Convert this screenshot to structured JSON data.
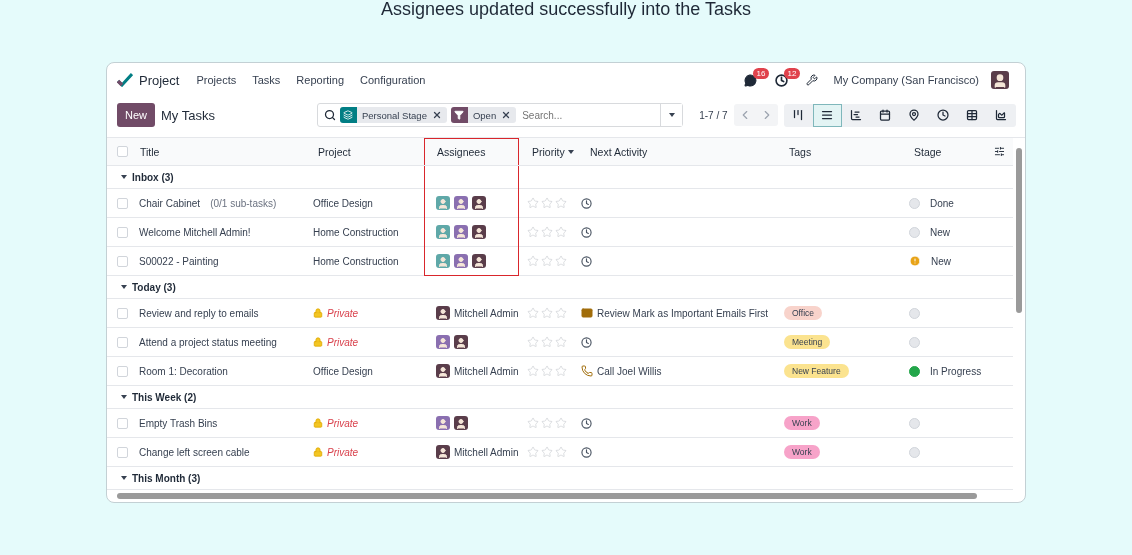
{
  "caption": "Assignees updated successfully into the Tasks",
  "navbar": {
    "app_name": "Project",
    "menu": [
      "Projects",
      "Tasks",
      "Reporting",
      "Configuration"
    ],
    "messages_count": "16",
    "activities_count": "12",
    "company": "My Company (San Francisco)"
  },
  "control_panel": {
    "new_button": "New",
    "title": "My Tasks",
    "facets": [
      {
        "kind": "group",
        "label": "Personal Stage"
      },
      {
        "kind": "filter",
        "label": "Open"
      }
    ],
    "search_placeholder": "Search...",
    "pager": "1-7 / 7",
    "views": [
      {
        "kind": "kanban",
        "selected": false
      },
      {
        "kind": "list",
        "selected": true
      },
      {
        "kind": "gantt",
        "selected": false
      },
      {
        "kind": "calendar",
        "selected": false
      },
      {
        "kind": "map",
        "selected": false
      },
      {
        "kind": "activity",
        "selected": false
      },
      {
        "kind": "pivot",
        "selected": false
      },
      {
        "kind": "graph",
        "selected": false
      }
    ]
  },
  "table": {
    "all_checked": false,
    "columns": [
      {
        "label": "Title",
        "highlighted": false,
        "sorted": false
      },
      {
        "label": "Project",
        "highlighted": false,
        "sorted": false
      },
      {
        "label": "Assignees",
        "highlighted": true,
        "sorted": false
      },
      {
        "label": "Priority",
        "highlighted": false,
        "sorted": true
      },
      {
        "label": "Next Activity",
        "highlighted": false,
        "sorted": false
      },
      {
        "label": "Tags",
        "highlighted": false,
        "sorted": false
      },
      {
        "label": "Stage",
        "highlighted": false,
        "sorted": false
      }
    ],
    "groups": [
      {
        "label": "Inbox (3)",
        "expanded": true,
        "highlighted": true,
        "rows": [
          {
            "checked": false,
            "title": "Chair Cabinet",
            "subtasks": "(0/1 sub-tasks)",
            "project": "Office Design",
            "private": false,
            "assignees": [
              {
                "color": "#5fa8a8"
              },
              {
                "color": "#8a6fb0"
              },
              {
                "color": "#5a3d4a"
              }
            ],
            "stars": 0,
            "activity": {
              "kind": "clock"
            },
            "stage": {
              "kind": "normal",
              "label": "Done"
            }
          },
          {
            "checked": false,
            "title": "Welcome Mitchell Admin!",
            "project": "Home Construction",
            "private": false,
            "assignees": [
              {
                "color": "#5fa8a8"
              },
              {
                "color": "#8a6fb0"
              },
              {
                "color": "#5a3d4a"
              }
            ],
            "stars": 0,
            "activity": {
              "kind": "clock"
            },
            "stage": {
              "kind": "normal",
              "label": "New"
            }
          },
          {
            "checked": false,
            "title": "S00022 - Painting",
            "project": "Home Construction",
            "private": false,
            "assignees": [
              {
                "color": "#5fa8a8"
              },
              {
                "color": "#8a6fb0"
              },
              {
                "color": "#5a3d4a"
              }
            ],
            "stars": 0,
            "activity": {
              "kind": "clock"
            },
            "stage": {
              "kind": "warning",
              "label": "New"
            }
          }
        ]
      },
      {
        "label": "Today (3)",
        "expanded": true,
        "highlighted": false,
        "rows": [
          {
            "checked": false,
            "title": "Review and reply to emails",
            "project": "Private",
            "private": true,
            "assignees": [
              {
                "color": "#5a3d4a"
              }
            ],
            "assignee_name": "Mitchell Admin",
            "stars": 0,
            "activity": {
              "kind": "email",
              "text": "Review Mark as Important Emails First"
            },
            "tag": {
              "label": "Office",
              "color": "#f8d3cb"
            },
            "stage": {
              "kind": "normal"
            }
          },
          {
            "checked": false,
            "title": "Attend a project status meeting",
            "project": "Private",
            "private": true,
            "assignees": [
              {
                "color": "#8a6fb0"
              },
              {
                "color": "#5a3d4a"
              }
            ],
            "stars": 0,
            "activity": {
              "kind": "clock"
            },
            "tag": {
              "label": "Meeting",
              "color": "#fbe38f"
            },
            "stage": {
              "kind": "normal"
            }
          },
          {
            "checked": false,
            "title": "Room 1: Decoration",
            "project": "Office Design",
            "private": false,
            "assignees": [
              {
                "color": "#5a3d4a"
              }
            ],
            "assignee_name": "Mitchell Admin",
            "stars": 0,
            "activity": {
              "kind": "phone",
              "text": "Call Joel Willis"
            },
            "tag": {
              "label": "New Feature",
              "color": "#fbe38f"
            },
            "stage": {
              "kind": "done",
              "label": "In Progress"
            }
          }
        ]
      },
      {
        "label": "This Week (2)",
        "expanded": true,
        "highlighted": false,
        "rows": [
          {
            "checked": false,
            "title": "Empty Trash Bins",
            "project": "Private",
            "private": true,
            "assignees": [
              {
                "color": "#8a6fb0"
              },
              {
                "color": "#5a3d4a"
              }
            ],
            "stars": 0,
            "activity": {
              "kind": "clock"
            },
            "tag": {
              "label": "Work",
              "color": "#f7a3c9"
            },
            "stage": {
              "kind": "normal"
            }
          },
          {
            "checked": false,
            "title": "Change left screen cable",
            "project": "Private",
            "private": true,
            "assignees": [
              {
                "color": "#5a3d4a"
              }
            ],
            "assignee_name": "Mitchell Admin",
            "stars": 0,
            "activity": {
              "kind": "clock"
            },
            "tag": {
              "label": "Work",
              "color": "#f7a3c9"
            },
            "stage": {
              "kind": "normal"
            }
          }
        ]
      },
      {
        "label": "This Month (3)",
        "expanded": true,
        "highlighted": false
      }
    ]
  }
}
